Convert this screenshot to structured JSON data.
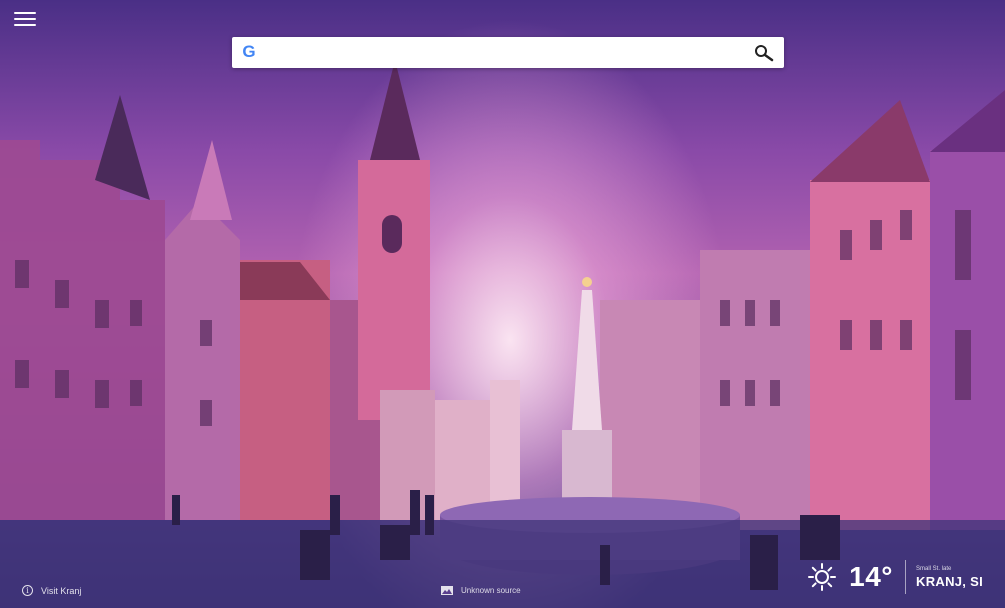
{
  "search": {
    "placeholder": "",
    "value": "",
    "google_glyph": "G"
  },
  "icons": {
    "menu": "hamburger-icon",
    "google": "google-g-icon",
    "search": "magnifier-icon",
    "info": "info-icon",
    "image": "image-icon",
    "weather": "sun-icon"
  },
  "footer": {
    "info_text": "Visit Kranj",
    "photo_credit": "Unknown source"
  },
  "weather": {
    "temperature": "14°",
    "small_label": "Small St. late",
    "location": "KRANJ, SI"
  },
  "colors": {
    "sky_top": "#4a2f86",
    "sky_glow": "#f0aadc",
    "buildings": "#9a4f8f",
    "search_bg": "#ffffff"
  }
}
